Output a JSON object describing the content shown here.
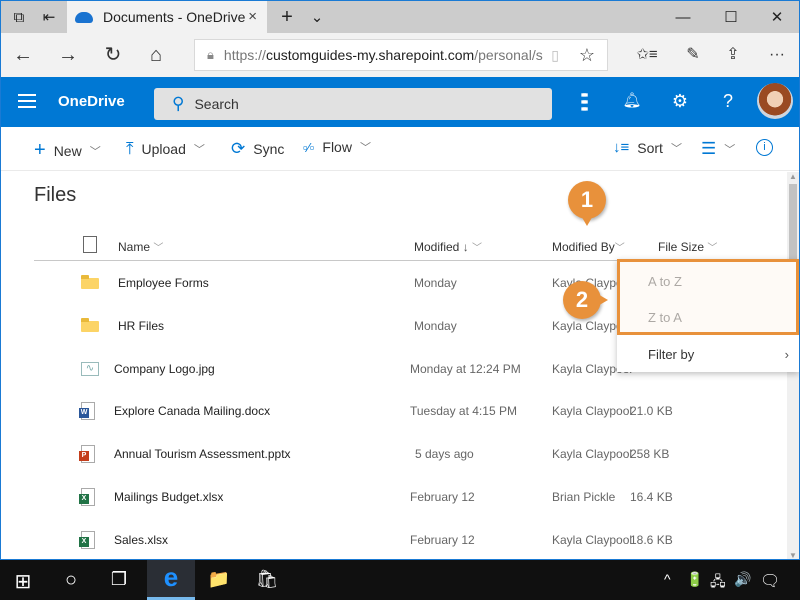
{
  "browser": {
    "tab_title": "Documents - OneDrive",
    "tab_close": "×",
    "new_tab": "+",
    "tab_list": "⌄",
    "window_controls": {
      "minimize": "—",
      "maximize": "☐",
      "close": "✕"
    },
    "nav": {
      "back": "←",
      "forward": "→",
      "refresh": "↻",
      "home": "⌂"
    },
    "url_protocol": "https://",
    "url_host": "customguides-my.sharepoint.com",
    "url_path": "/personal/s",
    "reading_view": "▯",
    "favorite": "☆",
    "toolbar_icons": {
      "favorites": "✩≡",
      "notes": "✎",
      "share": "⇪",
      "more": "···"
    }
  },
  "onedrive": {
    "brand": "OneDrive",
    "search_placeholder": "Search",
    "icons": {
      "apps": "⋮⋮⋮",
      "bell": "🔔",
      "settings": "⚙",
      "help": "?"
    },
    "accent": "#0078d4"
  },
  "commands": {
    "new": "New",
    "upload": "Upload",
    "sync": "Sync",
    "flow": "Flow",
    "sort": "Sort"
  },
  "files": {
    "title": "Files",
    "columns": {
      "name": "Name",
      "modified": "Modified",
      "modified_sort": "↓",
      "modified_by": "Modified By",
      "file_size": "File Size"
    },
    "rows": [
      {
        "name": "Employee Forms",
        "type": "folder",
        "modified": "Monday",
        "modified_by": "Kayla Claypool",
        "size": ""
      },
      {
        "name": "HR Files",
        "type": "folder",
        "modified": "Monday",
        "modified_by": "Kayla Claypool",
        "size": ""
      },
      {
        "name": "Company Logo.jpg",
        "type": "image",
        "modified": "Monday at 12:24 PM",
        "modified_by": "Kayla Claypool",
        "size": ""
      },
      {
        "name": "Explore Canada Mailing.docx",
        "type": "word",
        "modified": "Tuesday at 4:15 PM",
        "modified_by": "Kayla Claypool",
        "size": "21.0 KB"
      },
      {
        "name": "Annual Tourism Assessment.pptx",
        "type": "powerpoint",
        "modified": "5 days ago",
        "modified_by": "Kayla Claypool",
        "size": "258 KB"
      },
      {
        "name": "Mailings Budget.xlsx",
        "type": "excel",
        "modified": "February 12",
        "modified_by": "Brian Pickle",
        "size": "16.4 KB"
      },
      {
        "name": "Sales.xlsx",
        "type": "excel",
        "modified": "February 12",
        "modified_by": "Kayla Claypool",
        "size": "18.6 KB"
      }
    ]
  },
  "menu": {
    "items": [
      "A to Z",
      "Z to A",
      "Filter by"
    ],
    "submenu_arrow": "›"
  },
  "callouts": [
    "1",
    "2"
  ],
  "callout_color": "#e8913b",
  "taskbar": {
    "start": "⊞",
    "cortana": "○",
    "task_view": "❐",
    "edge": "e",
    "explorer": "📁",
    "store": "🛍",
    "tray": {
      "chevron": "^",
      "battery": "🔋",
      "network": "🖧",
      "volume": "🔊",
      "action_center": "🗨"
    }
  }
}
